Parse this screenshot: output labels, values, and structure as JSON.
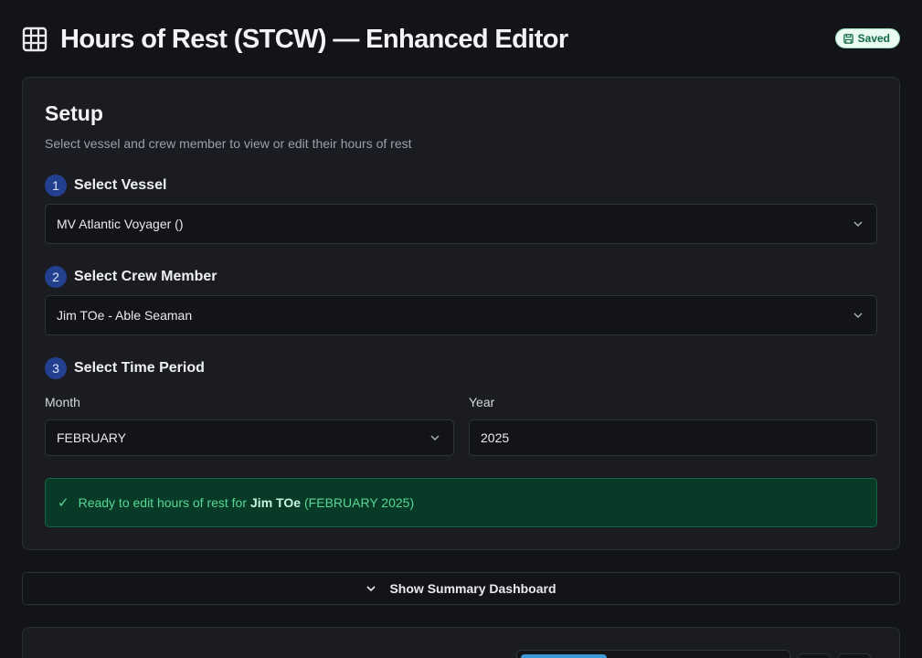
{
  "header": {
    "title": "Hours of Rest (STCW) — Enhanced Editor",
    "icon": "table-grid-icon",
    "saved_label": "Saved"
  },
  "setup": {
    "title": "Setup",
    "description": "Select vessel and crew member to view or edit their hours of rest",
    "steps": [
      {
        "number": "1",
        "label": "Select Vessel"
      },
      {
        "number": "2",
        "label": "Select Crew Member"
      },
      {
        "number": "3",
        "label": "Select Time Period"
      }
    ],
    "vessel": {
      "value": "MV Atlantic Voyager ()"
    },
    "crew": {
      "value": "Jim TOe - Able Seaman"
    },
    "month": {
      "label": "Month",
      "value": "FEBRUARY"
    },
    "year": {
      "label": "Year",
      "value": "2025"
    },
    "status": {
      "prefix": "Ready to edit hours of rest for",
      "name": "Jim TOe",
      "suffix": "(FEBRUARY 2025)"
    }
  },
  "summary": {
    "toggle_label": "Show Summary Dashboard"
  },
  "colors": {
    "background": "#131418",
    "card": "#1a1c21",
    "step_badge": "#23408f",
    "success_bg": "#083a28",
    "success_text": "#56d895",
    "saved_badge_bg": "#e9fbf2",
    "accent_tab": "#3b9bd9"
  }
}
